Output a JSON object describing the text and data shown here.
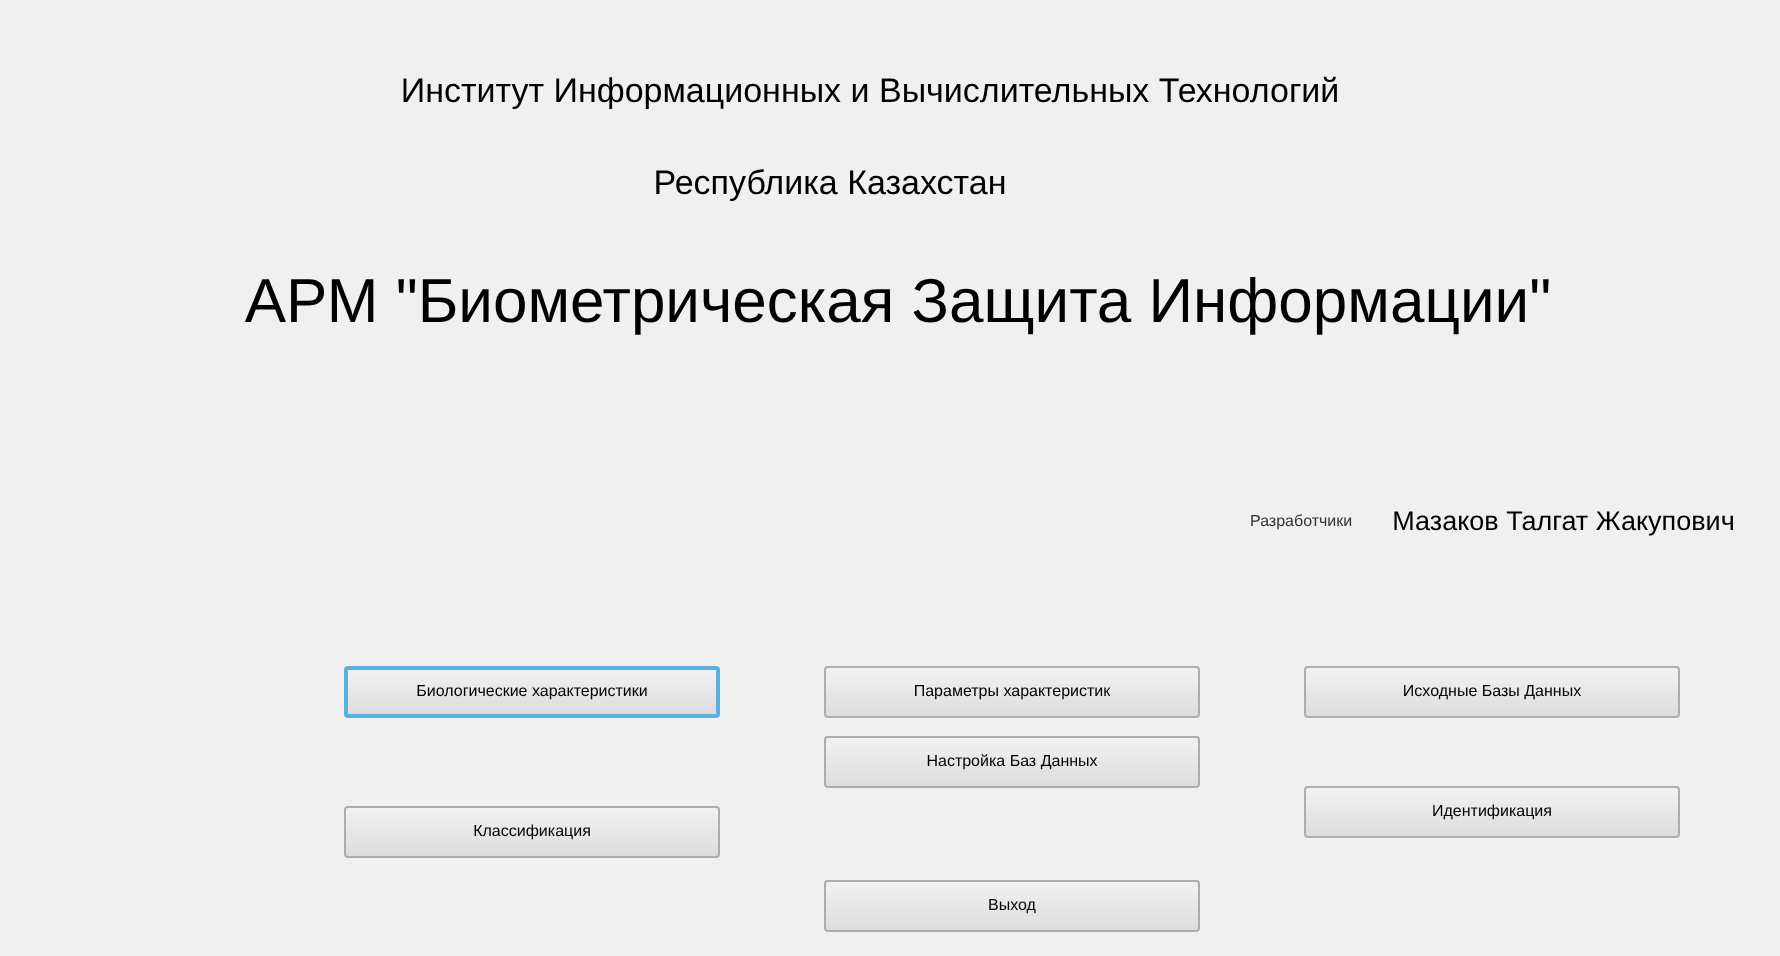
{
  "header": {
    "institute": "Институт Информационных и Вычислительных Технологий",
    "country": "Республика Казахстан",
    "title": "АРМ \"Биометрическая Защита Информации\""
  },
  "developers": {
    "label": "Разработчики",
    "name": "Мазаков Талгат Жакупович"
  },
  "button_columns": [
    {
      "buttons": [
        {
          "label": "Биологические характеристики",
          "focused": true
        },
        {
          "label": "Классификация",
          "focused": false
        }
      ]
    },
    {
      "buttons": [
        {
          "label": "Параметры характеристик",
          "focused": false
        },
        {
          "label": "Настройка Баз Данных",
          "focused": false
        },
        {
          "label": "Выход",
          "focused": false
        }
      ]
    },
    {
      "buttons": [
        {
          "label": "Исходные Базы Данных",
          "focused": false
        },
        {
          "label": "Идентификация",
          "focused": false
        }
      ]
    }
  ]
}
